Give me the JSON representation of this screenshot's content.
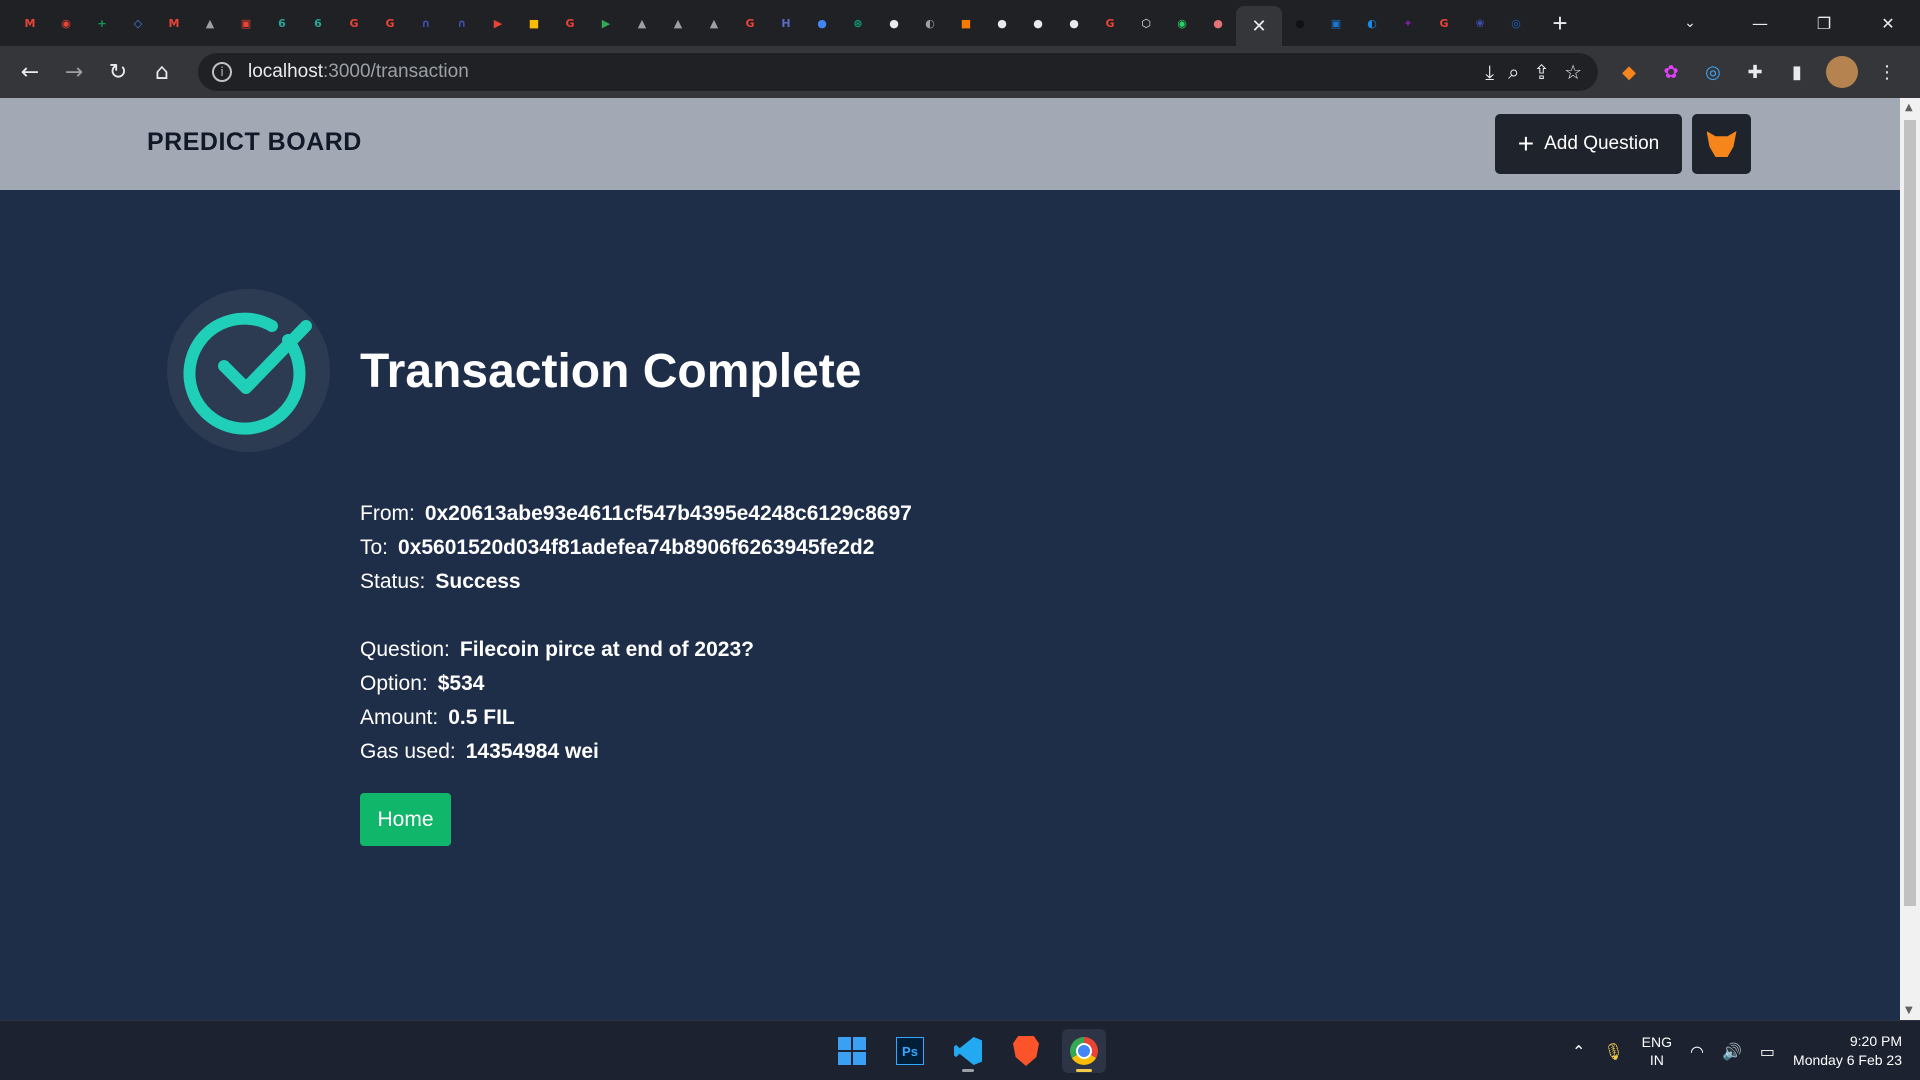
{
  "browser": {
    "favicons": [
      {
        "name": "gmail-icon",
        "glyph": "M",
        "color": "#ea4335"
      },
      {
        "name": "app-icon",
        "glyph": "◉",
        "color": "#ea4335"
      },
      {
        "name": "sheets-icon",
        "glyph": "+",
        "color": "#0f9d58"
      },
      {
        "name": "app-icon",
        "glyph": "◇",
        "color": "#4285f4"
      },
      {
        "name": "gmail-icon",
        "glyph": "M",
        "color": "#ea4335"
      },
      {
        "name": "page-icon",
        "glyph": "▲",
        "color": "#9aa0a6"
      },
      {
        "name": "app-icon",
        "glyph": "▣",
        "color": "#ea4335"
      },
      {
        "name": "app-icon",
        "glyph": "6",
        "color": "#26a69a"
      },
      {
        "name": "app-icon",
        "glyph": "6",
        "color": "#26a69a"
      },
      {
        "name": "google-icon",
        "glyph": "G",
        "color": "#ea4335"
      },
      {
        "name": "google-icon",
        "glyph": "G",
        "color": "#ea4335"
      },
      {
        "name": "app-icon",
        "glyph": "∩",
        "color": "#3f51b5"
      },
      {
        "name": "app-icon",
        "glyph": "∩",
        "color": "#3f51b5"
      },
      {
        "name": "youtube-icon",
        "glyph": "▶",
        "color": "#ea4335"
      },
      {
        "name": "keep-icon",
        "glyph": "■",
        "color": "#fbbc05"
      },
      {
        "name": "google-icon",
        "glyph": "G",
        "color": "#ea4335"
      },
      {
        "name": "play-icon",
        "glyph": "▶",
        "color": "#34a853"
      },
      {
        "name": "page-icon",
        "glyph": "▲",
        "color": "#9aa0a6"
      },
      {
        "name": "page-icon",
        "glyph": "▲",
        "color": "#9aa0a6"
      },
      {
        "name": "page-icon",
        "glyph": "▲",
        "color": "#9aa0a6"
      },
      {
        "name": "google-icon",
        "glyph": "G",
        "color": "#ea4335"
      },
      {
        "name": "app-icon",
        "glyph": "H",
        "color": "#5c6bc0"
      },
      {
        "name": "app-icon",
        "glyph": "●",
        "color": "#4285f4"
      },
      {
        "name": "chatgpt-icon",
        "glyph": "⊛",
        "color": "#10a37f"
      },
      {
        "name": "github-icon",
        "glyph": "●",
        "color": "#e8eaed"
      },
      {
        "name": "app-icon",
        "glyph": "◐",
        "color": "#9aa0a6"
      },
      {
        "name": "app-icon",
        "glyph": "■",
        "color": "#f57c00"
      },
      {
        "name": "github-icon",
        "glyph": "●",
        "color": "#e8eaed"
      },
      {
        "name": "github-icon",
        "glyph": "●",
        "color": "#e8eaed"
      },
      {
        "name": "github-icon",
        "glyph": "●",
        "color": "#e8eaed"
      },
      {
        "name": "google-icon",
        "glyph": "G",
        "color": "#ea4335"
      },
      {
        "name": "codesandbox-icon",
        "glyph": "⬡",
        "color": "#e8eaed"
      },
      {
        "name": "whatsapp-icon",
        "glyph": "◉",
        "color": "#25d366"
      },
      {
        "name": "app-icon",
        "glyph": "●",
        "color": "#e57373"
      }
    ],
    "favicons_after": [
      {
        "name": "app-icon",
        "glyph": "●",
        "color": "#111111"
      },
      {
        "name": "app-icon",
        "glyph": "▣",
        "color": "#1976d2"
      },
      {
        "name": "app-icon",
        "glyph": "◐",
        "color": "#1e88e5"
      },
      {
        "name": "app-icon",
        "glyph": "✦",
        "color": "#7b1fa2"
      },
      {
        "name": "google-icon",
        "glyph": "G",
        "color": "#ea4335"
      },
      {
        "name": "app-icon",
        "glyph": "❀",
        "color": "#3f51b5"
      },
      {
        "name": "app-icon",
        "glyph": "◎",
        "color": "#1565c0"
      }
    ],
    "url_host": "localhost",
    "url_path": ":3000/transaction"
  },
  "header": {
    "brand": "PREDICT BOARD",
    "add_question_label": "Add Question"
  },
  "transaction": {
    "title": "Transaction Complete",
    "from_label": "From:",
    "from_value": "0x20613abe93e4611cf547b4395e4248c6129c8697",
    "to_label": "To:",
    "to_value": "0x5601520d034f81adefea74b8906f6263945fe2d2",
    "status_label": "Status:",
    "status_value": "Success",
    "question_label": "Question:",
    "question_value": "Filecoin pirce at end of 2023?",
    "option_label": "Option:",
    "option_value": "$534",
    "amount_label": "Amount:",
    "amount_value": "0.5 FIL",
    "gas_label": "Gas used:",
    "gas_value": "14354984 wei",
    "home_label": "Home"
  },
  "taskbar": {
    "lang_line1": "ENG",
    "lang_line2": "IN",
    "time": "9:20 PM",
    "date": "Monday 6 Feb 23"
  },
  "colors": {
    "page_bg": "#1f2e48",
    "header_bg": "#a2a9b4",
    "check_accent": "#1fcfb8",
    "home_button": "#10b66a"
  }
}
